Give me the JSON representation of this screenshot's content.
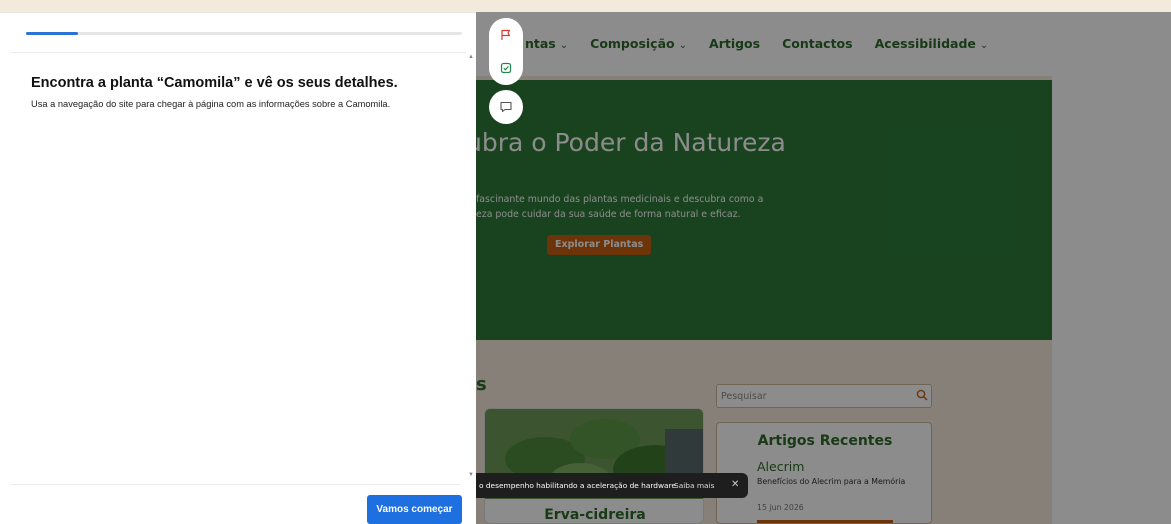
{
  "site": {
    "nav": [
      {
        "label": "ntas",
        "has_dropdown": true
      },
      {
        "label": "Composição",
        "has_dropdown": true
      },
      {
        "label": "Artigos",
        "has_dropdown": false
      },
      {
        "label": "Contactos",
        "has_dropdown": false
      },
      {
        "label": "Acessibilidade",
        "has_dropdown": true
      }
    ],
    "hero": {
      "title": "ubra o Poder da Natureza",
      "text_line1": "fascinante mundo das plantas medicinais e descubra como a",
      "text_line2": "eza pode cuidar da sua saúde de forma natural e eficaz.",
      "button": "Explorar Plantas"
    },
    "section_heading_fragment": "s",
    "card_title": "Erva-cidreira",
    "search_placeholder": "Pesquisar",
    "recent": {
      "title": "Artigos Recentes",
      "article_name": "Alecrim",
      "article_desc": "Benefícios do Alecrim para a Memória",
      "article_date": "15 jun 2026"
    }
  },
  "toast": {
    "message": "o desempenho habilitando a aceleração de hardware",
    "link": "Saiba mais",
    "close": "✕"
  },
  "panel": {
    "progress_fraction": 0.12,
    "task_title": "Encontra a planta “Camomila” e vê os seus detalhes.",
    "task_description": "Usa a navegação do site para chegar à página com as informações sobre a Camomila.",
    "start_button": "Vamos começar"
  },
  "colors": {
    "accent_blue": "#1e6fe0",
    "site_green": "#2e7b3a",
    "site_orange": "#c75f12"
  }
}
